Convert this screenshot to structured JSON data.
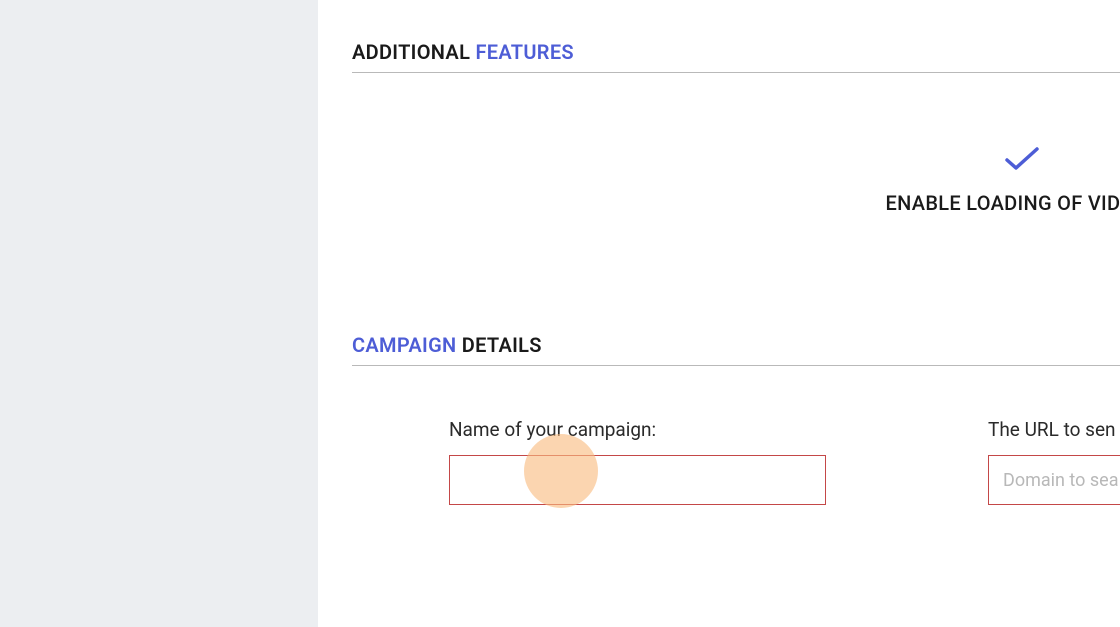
{
  "sections": {
    "additional": {
      "title_part1": "ADDITIONAL ",
      "title_part2": "FEATURES"
    },
    "campaign": {
      "title_part1": "CAMPAIGN ",
      "title_part2": "DETAILS"
    }
  },
  "features": {
    "enable_videos": {
      "label": "ENABLE LOADING OF VIDEOS"
    }
  },
  "form": {
    "campaign_name": {
      "label": "Name of your campaign:",
      "value": ""
    },
    "url": {
      "label": "The URL to sen",
      "placeholder": "Domain to sea",
      "value": ""
    }
  }
}
